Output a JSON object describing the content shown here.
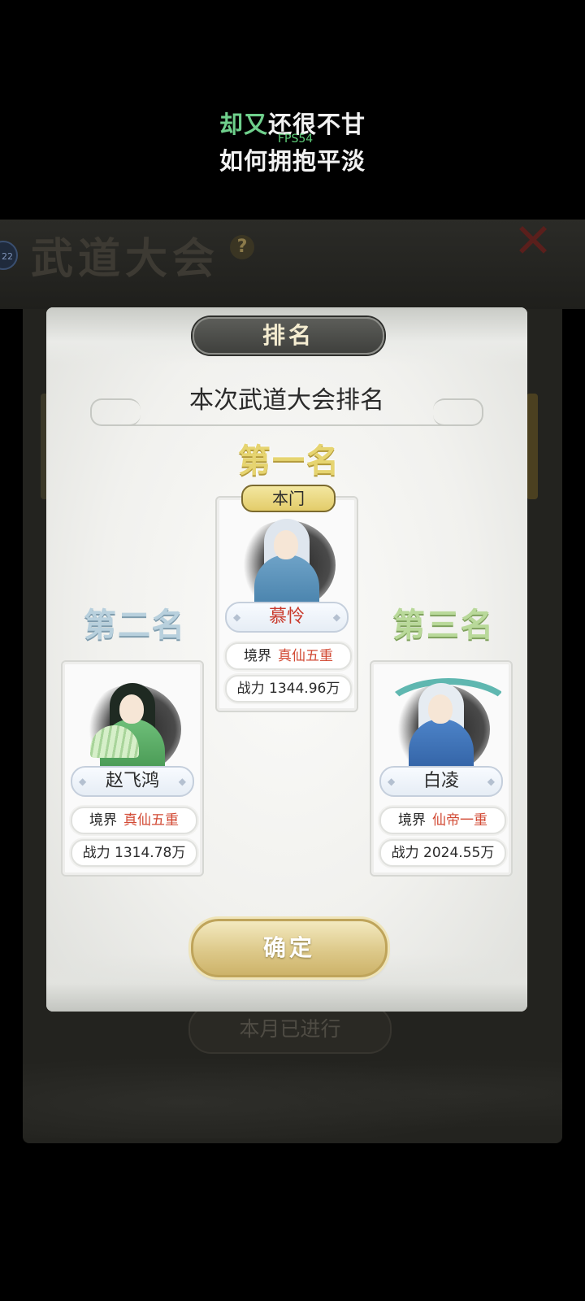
{
  "overlay": {
    "lyric_line1_highlight": "却又",
    "lyric_line1_rest": "还很不甘",
    "lyric_line2": "如何拥抱平淡",
    "fps": "FPS54"
  },
  "background": {
    "title": "武道大会",
    "help_glyph": "?",
    "close_glyph": "✕",
    "level": "22",
    "month_status": "本月已进行"
  },
  "modal": {
    "header": "排名",
    "subtitle": "本次武道大会排名",
    "confirm_label": "确定",
    "ranks": {
      "first": {
        "label": "第一名",
        "badge": "本门",
        "name": "慕怜",
        "realm_label": "境界",
        "realm_value": "真仙五重",
        "power": "战力 1344.96万"
      },
      "second": {
        "label": "第二名",
        "name": "赵飞鸿",
        "realm_label": "境界",
        "realm_value": "真仙五重",
        "power": "战力 1314.78万"
      },
      "third": {
        "label": "第三名",
        "name": "白凌",
        "realm_label": "境界",
        "realm_value": "仙帝一重",
        "power": "战力 2024.55万"
      }
    }
  }
}
